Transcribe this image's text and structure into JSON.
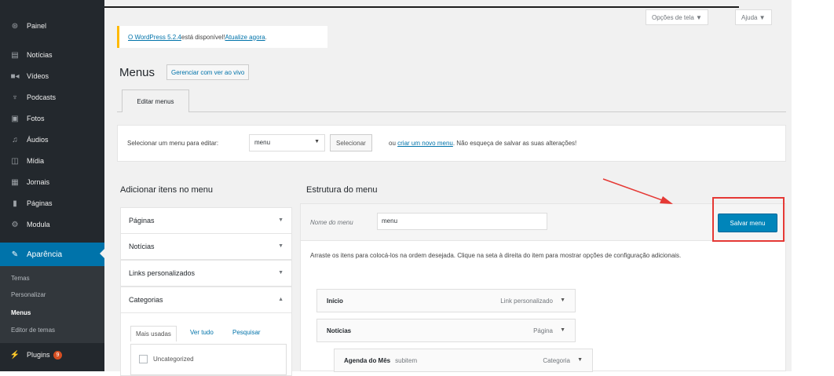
{
  "sidebar": {
    "items": [
      {
        "label": "Painel",
        "icon": "dashboard-icon",
        "glyph": "⊛"
      },
      {
        "label": "Notícias",
        "icon": "posts-icon",
        "glyph": "▤"
      },
      {
        "label": "Vídeos",
        "icon": "video-icon",
        "glyph": "■◂"
      },
      {
        "label": "Podcasts",
        "icon": "microphone-icon",
        "glyph": "♆"
      },
      {
        "label": "Fotos",
        "icon": "image-icon",
        "glyph": "▣"
      },
      {
        "label": "Áudios",
        "icon": "audio-icon",
        "glyph": "♫"
      },
      {
        "label": "Mídia",
        "icon": "media-icon",
        "glyph": "◫"
      },
      {
        "label": "Jornais",
        "icon": "newspaper-icon",
        "glyph": "▦"
      },
      {
        "label": "Páginas",
        "icon": "pages-icon",
        "glyph": "▮"
      },
      {
        "label": "Modula",
        "icon": "gear-icon",
        "glyph": "⚙"
      },
      {
        "label": "Aparência",
        "icon": "brush-icon",
        "glyph": "✎"
      }
    ],
    "submenu": [
      "Temas",
      "Personalizar",
      "Menus",
      "Editor de temas"
    ],
    "plugins": {
      "label": "Plugins",
      "badge": "9",
      "icon": "plugins-icon",
      "glyph": "⚡"
    }
  },
  "screen_options": {
    "options": "Opções de tela ▼",
    "help": "Ajuda ▼"
  },
  "notice": {
    "version_link": "O WordPress 5.2.4",
    "text": " está disponível! ",
    "update_link": "Atualize agora",
    "end": "."
  },
  "page": {
    "title": "Menus",
    "manage_btn": "Gerenciar com ver ao vivo",
    "tab": "Editar menus"
  },
  "select_bar": {
    "label": "Selecionar um menu para editar:",
    "value": "menu",
    "button": "Selecionar",
    "or": "ou",
    "create_link": "criar um novo menu",
    "reminder": ". Não esqueça de salvar as suas alterações!"
  },
  "left": {
    "heading": "Adicionar itens no menu",
    "sections": [
      "Páginas",
      "Notícias",
      "Links personalizados",
      "Categorias"
    ],
    "cat_tabs": [
      "Mais usadas",
      "Ver tudo",
      "Pesquisar"
    ],
    "cat_item": "Uncategorized"
  },
  "right": {
    "heading": "Estrutura do menu",
    "name_label": "Nome do menu",
    "name_value": "menu",
    "save_btn": "Salvar menu",
    "instructions": "Arraste os itens para colocá-los na ordem desejada. Clique na seta à direita do item para mostrar opções de configuração adicionais.",
    "items": [
      {
        "title": "Início",
        "sub": "",
        "type": "Link personalizado"
      },
      {
        "title": "Notícias",
        "sub": "",
        "type": "Página"
      },
      {
        "title": "Agenda do Mês",
        "sub": "subitem",
        "type": "Categoria"
      }
    ]
  },
  "colors": {
    "sidebar": "#23282d",
    "accent": "#0073aa",
    "save_button": "#0085ba",
    "highlight": "#e53935",
    "notice": "#ffb900"
  }
}
